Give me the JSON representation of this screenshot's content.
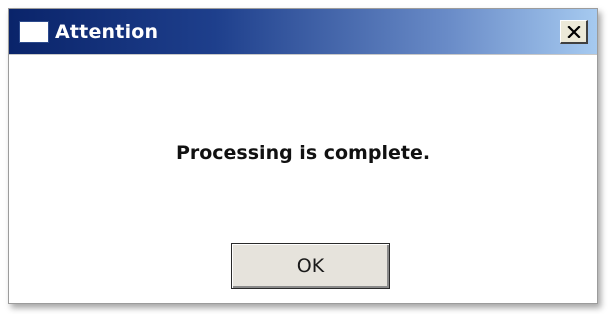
{
  "window": {
    "title": "Attention",
    "close_icon": "close-icon"
  },
  "message": {
    "text": "Processing is complete."
  },
  "buttons": {
    "ok_label": "OK"
  },
  "colors": {
    "titlebar_start": "#0a246a",
    "titlebar_end": "#a6caf0",
    "button_face": "#e6e3dc"
  }
}
